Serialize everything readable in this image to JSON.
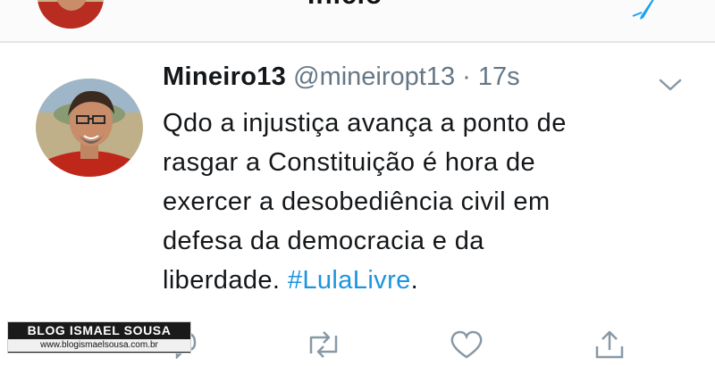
{
  "header": {
    "title": "Início",
    "compose_icon": "feather-compose-icon",
    "avatar_icon": "profile-avatar"
  },
  "tweet": {
    "name": "Mineiro13",
    "handle": "@mineiropt13",
    "separator": "·",
    "time": "17s",
    "text_lines": [
      "Qdo a injustiça avança a ponto de",
      "rasgar a Constituição é hora de",
      "exercer a desobediência civil em",
      "defesa da democracia e da",
      "liberdade."
    ],
    "hashtag": "#LulaLivre",
    "trailing": ".",
    "menu_icon": "chevron-down-icon"
  },
  "actions": [
    "reply-icon",
    "retweet-icon",
    "like-icon",
    "share-icon"
  ],
  "watermark": {
    "title": "BLOG ISMAEL SOUSA",
    "url": "www.blogismaelsousa.com.br"
  },
  "colors": {
    "link": "#1b95e0",
    "secondary_text": "#657786",
    "icon": "#8899a6"
  }
}
